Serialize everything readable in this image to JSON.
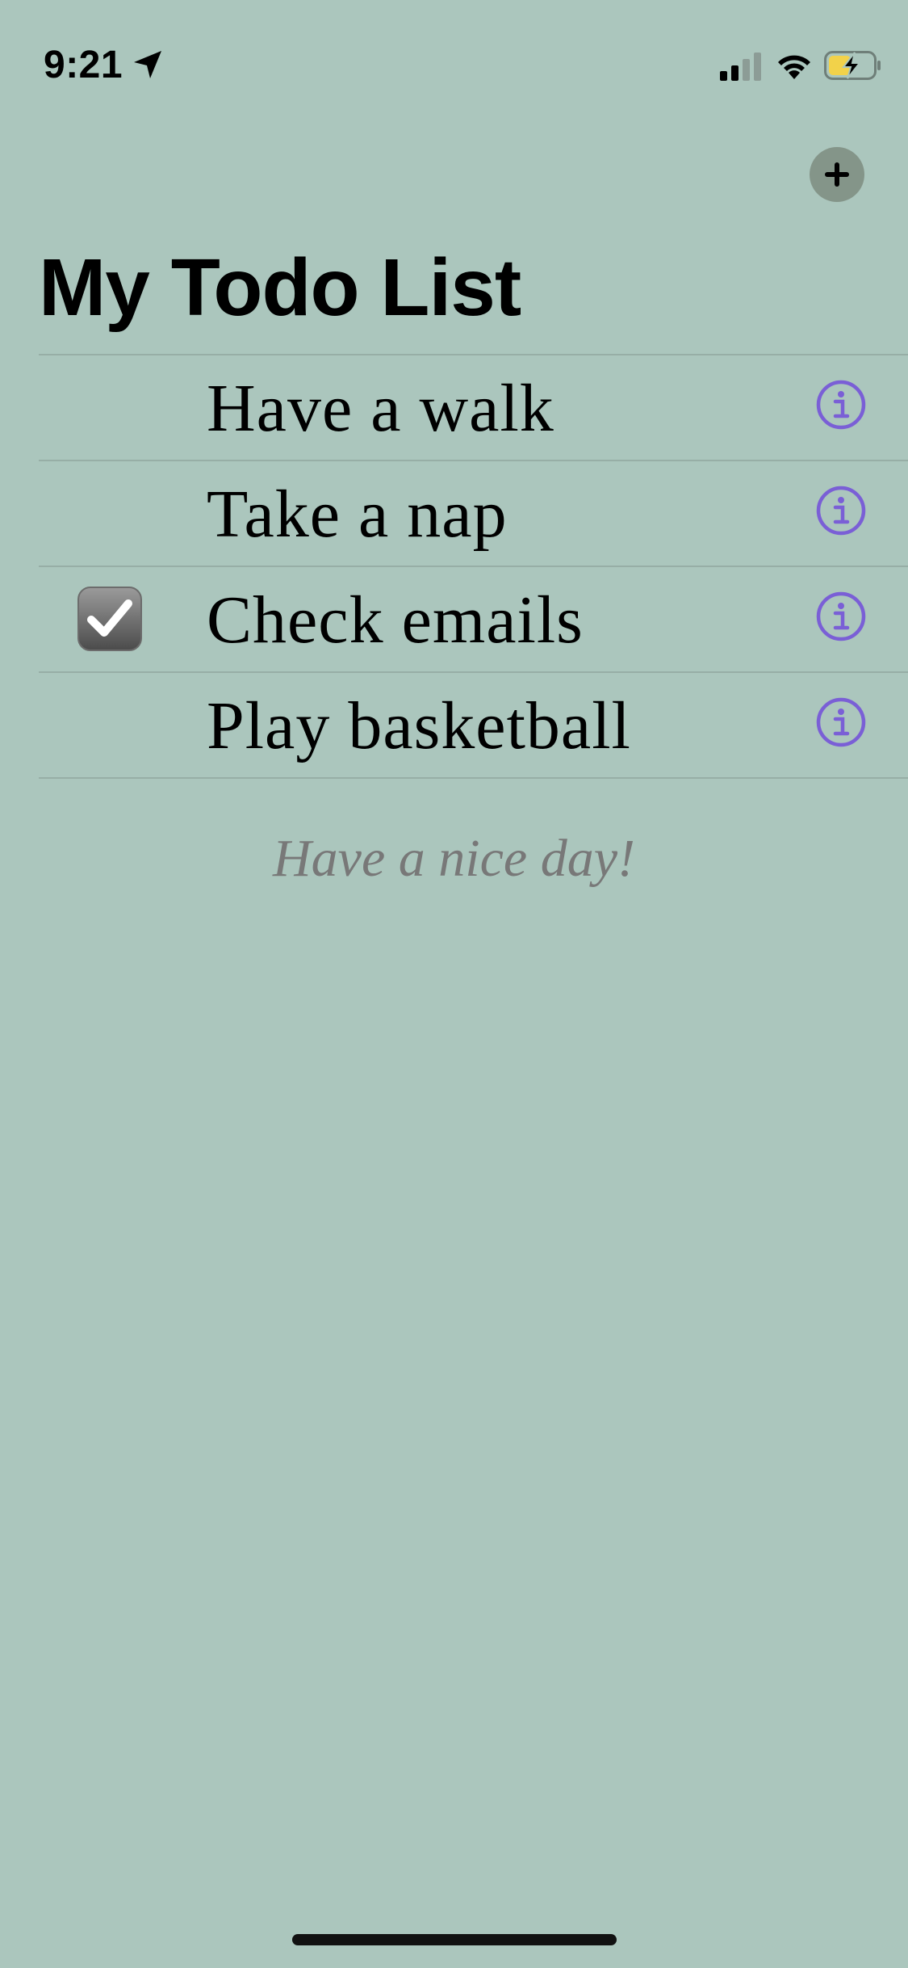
{
  "status_bar": {
    "time": "9:21",
    "location_icon": "location-arrow-icon",
    "signal_icon": "cellular-signal-icon",
    "wifi_icon": "wifi-icon",
    "battery_icon": "battery-charging-icon"
  },
  "header": {
    "add_icon": "plus-icon",
    "title": "My Todo List"
  },
  "todos": [
    {
      "label": "Have a walk",
      "checked": false
    },
    {
      "label": "Take a nap",
      "checked": false
    },
    {
      "label": "Check emails",
      "checked": true
    },
    {
      "label": "Play basketball",
      "checked": false
    }
  ],
  "footer": {
    "message": "Have a nice day!"
  },
  "colors": {
    "background": "#abc6bd",
    "accent": "#7a5fd6",
    "add_button_bg": "#849589",
    "footer_text": "#787878"
  }
}
